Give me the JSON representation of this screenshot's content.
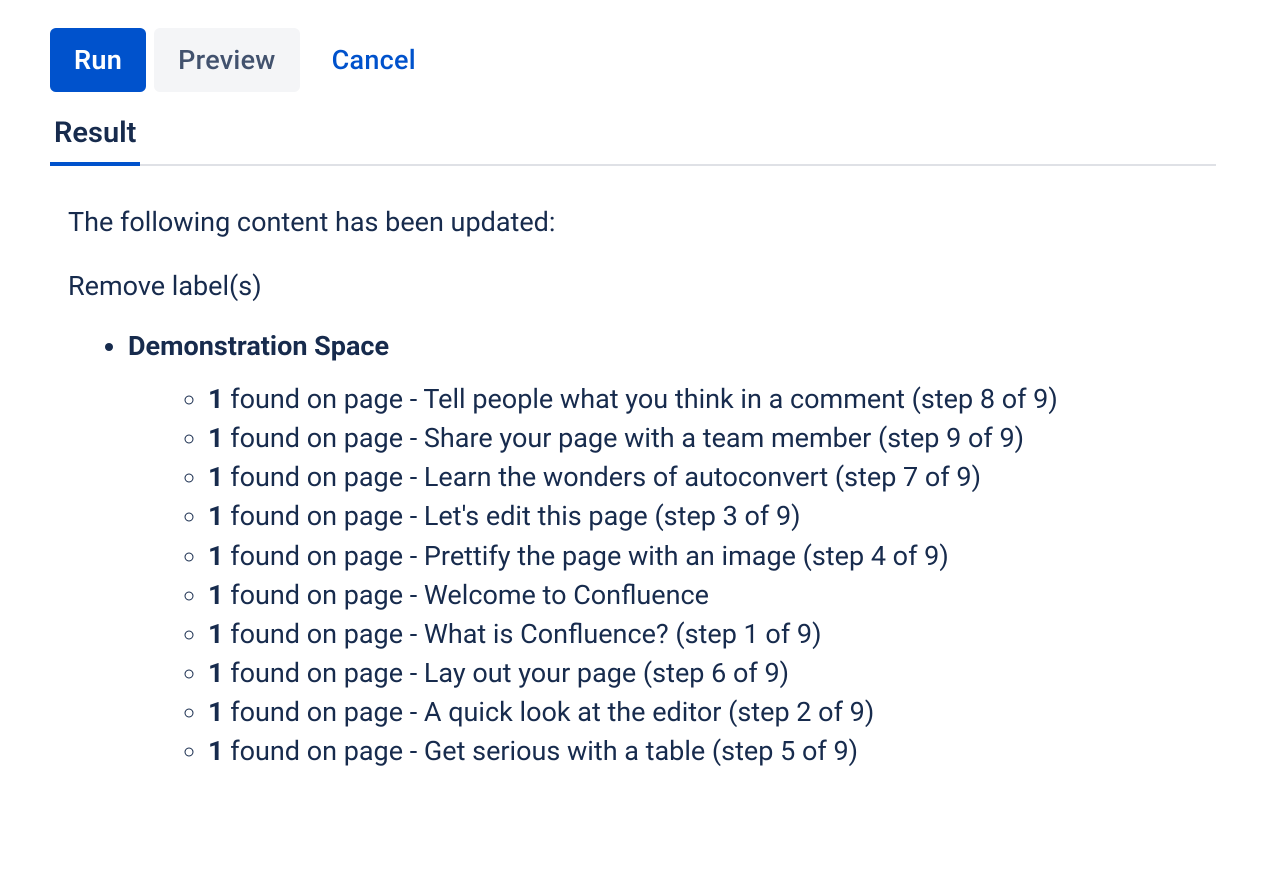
{
  "toolbar": {
    "run_label": "Run",
    "preview_label": "Preview",
    "cancel_label": "Cancel"
  },
  "tabs": {
    "result_label": "Result"
  },
  "result": {
    "intro": "The following content has been updated:",
    "action": "Remove label(s)",
    "spaces": [
      {
        "name": "Demonstration Space",
        "pages": [
          {
            "count": "1",
            "text": " found on page - Tell people what you think in a comment (step 8 of 9)"
          },
          {
            "count": "1",
            "text": " found on page - Share your page with a team member (step 9 of 9)"
          },
          {
            "count": "1",
            "text": " found on page - Learn the wonders of autoconvert (step 7 of 9)"
          },
          {
            "count": "1",
            "text": " found on page - Let's edit this page (step 3 of 9)"
          },
          {
            "count": "1",
            "text": " found on page - Prettify the page with an image (step 4 of 9)"
          },
          {
            "count": "1",
            "text": " found on page - Welcome to Confluence"
          },
          {
            "count": "1",
            "text": " found on page - What is Confluence? (step 1 of 9)"
          },
          {
            "count": "1",
            "text": " found on page - Lay out your page (step 6 of 9)"
          },
          {
            "count": "1",
            "text": " found on page - A quick look at the editor (step 2 of 9)"
          },
          {
            "count": "1",
            "text": " found on page - Get serious with a table (step 5 of 9)"
          }
        ]
      }
    ]
  }
}
